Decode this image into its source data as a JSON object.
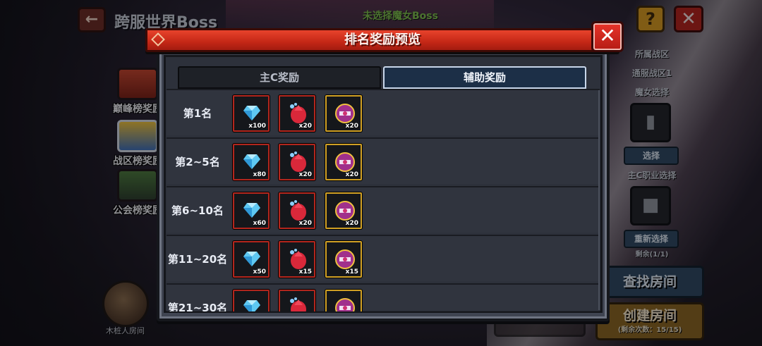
{
  "background": {
    "title": "跨服世界Boss",
    "status_text": "未选择魔女Boss",
    "help_icon": "?",
    "side_tabs": [
      {
        "label": "巅峰榜奖励"
      },
      {
        "label": "战区榜奖励"
      },
      {
        "label": "公会榜奖励"
      }
    ],
    "dummy_room_label": "木桩人房间",
    "right_panel": {
      "zone_title": "所属战区",
      "zone_value": "通服战区1",
      "witch_select_title": "魔女选择",
      "select_button": "选择",
      "main_class_title": "主C职业选择",
      "reselect_button": "重新选择",
      "remaining": "剩余(1/1)",
      "find_room": "查找房间",
      "create_room": "创建房间",
      "create_room_sub": "(剩余次数：15/15)"
    }
  },
  "modal": {
    "title": "排名奖励预览",
    "tabs": [
      {
        "label": "主C奖励",
        "active": false
      },
      {
        "label": "辅助奖励",
        "active": true
      }
    ],
    "rows": [
      {
        "rank": "第1名",
        "rewards": [
          {
            "item": "diamond",
            "qty": "x100"
          },
          {
            "item": "red-crystal",
            "qty": "x20"
          },
          {
            "item": "purple-orb",
            "qty": "x20"
          }
        ]
      },
      {
        "rank": "第2~5名",
        "rewards": [
          {
            "item": "diamond",
            "qty": "x80"
          },
          {
            "item": "red-crystal",
            "qty": "x20"
          },
          {
            "item": "purple-orb",
            "qty": "x20"
          }
        ]
      },
      {
        "rank": "第6~10名",
        "rewards": [
          {
            "item": "diamond",
            "qty": "x60"
          },
          {
            "item": "red-crystal",
            "qty": "x20"
          },
          {
            "item": "purple-orb",
            "qty": "x20"
          }
        ]
      },
      {
        "rank": "第11~20名",
        "rewards": [
          {
            "item": "diamond",
            "qty": "x50"
          },
          {
            "item": "red-crystal",
            "qty": "x15"
          },
          {
            "item": "purple-orb",
            "qty": "x15"
          }
        ]
      },
      {
        "rank": "第21~30名",
        "rewards": [
          {
            "item": "diamond",
            "qty": ""
          },
          {
            "item": "red-crystal",
            "qty": ""
          },
          {
            "item": "purple-orb",
            "qty": ""
          }
        ]
      }
    ]
  },
  "colors": {
    "header_red": "#c42716",
    "tab_active": "#1c2f47",
    "reward_border_red": "#b3261d",
    "reward_border_gold": "#d0a024",
    "diamond": "#5ec8f2",
    "crystal": "#d9283a",
    "orb": "#a0308c"
  }
}
